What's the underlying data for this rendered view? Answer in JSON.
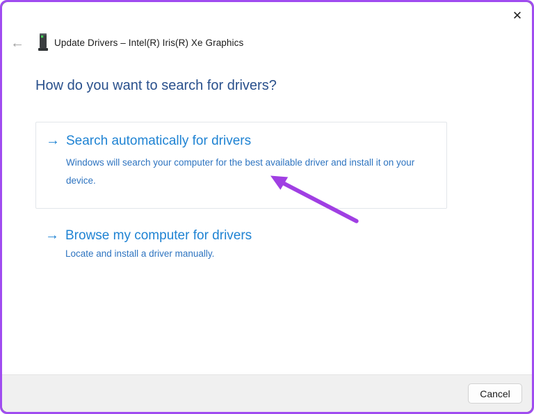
{
  "window": {
    "title": "Update Drivers – Intel(R) Iris(R) Xe Graphics"
  },
  "icons": {
    "close": "✕",
    "back": "←",
    "option_arrow": "→",
    "device": "display-adapter-icon"
  },
  "content": {
    "heading": "How do you want to search for drivers?"
  },
  "options": [
    {
      "title": "Search automatically for drivers",
      "description": "Windows will search your computer for the best available driver and install it on your device."
    },
    {
      "title": "Browse my computer for drivers",
      "description": "Locate and install a driver manually."
    }
  ],
  "footer": {
    "cancel_label": "Cancel"
  },
  "annotation": {
    "arrow_color": "#a03fe3"
  },
  "colors": {
    "frame_border": "#a04cf0",
    "heading_text": "#29508c",
    "link_title": "#1f83d3",
    "link_description": "#2e74c0",
    "footer_background": "#f0f0f0"
  }
}
